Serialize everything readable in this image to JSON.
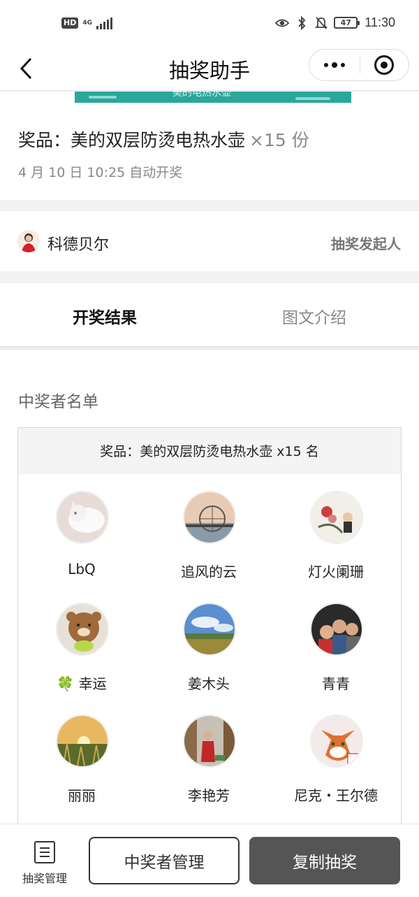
{
  "status_bar": {
    "hd": "HD",
    "network": "4G",
    "battery": "47",
    "time": "11:30"
  },
  "nav": {
    "title": "抽奖助手"
  },
  "banner": {
    "text": "美的电热水壶",
    "color": "#2aa79b"
  },
  "prize": {
    "title": "奖品：美的双层防烫电热水壶",
    "quantity": "×15 份",
    "draw_time": "4 月 10 日 10:25 自动开奖"
  },
  "initiator": {
    "name": "科德贝尔",
    "role": "抽奖发起人"
  },
  "tabs": [
    {
      "label": "开奖结果",
      "active": true
    },
    {
      "label": "图文介绍",
      "active": false
    }
  ],
  "winners": {
    "heading": "中奖者名单",
    "prize_line": "奖品：美的双层防烫电热水壶 x15 名",
    "list": [
      {
        "name": "LbQ"
      },
      {
        "name": "追风的云"
      },
      {
        "name": "灯火阑珊"
      },
      {
        "name": "🍀 幸运"
      },
      {
        "name": "姜木头"
      },
      {
        "name": "青青"
      },
      {
        "name": "丽丽"
      },
      {
        "name": "李艳芳"
      },
      {
        "name": "尼克・王尔德"
      }
    ]
  },
  "bottom_bar": {
    "manage_label": "抽奖管理",
    "winners_button": "中奖者管理",
    "copy_button": "复制抽奖"
  }
}
